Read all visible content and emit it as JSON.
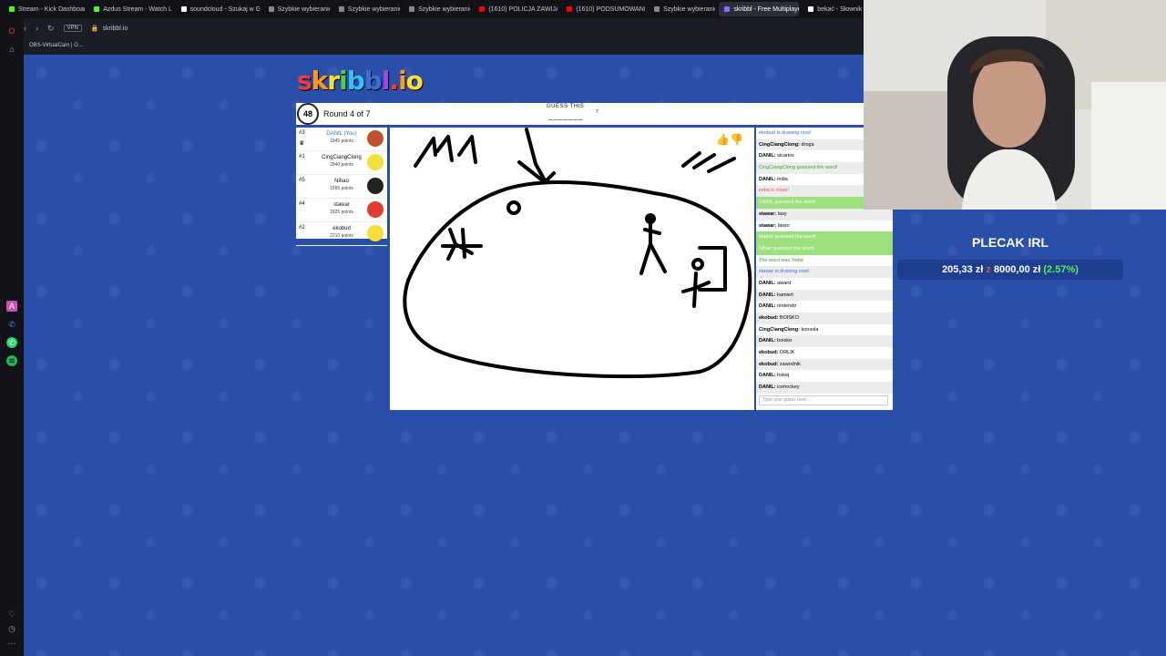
{
  "browser": {
    "tabs": [
      {
        "label": "Stream - Kick Dashboard",
        "color": "#53fc18"
      },
      {
        "label": "Azdus Stream - Watch Liv",
        "color": "#53fc18"
      },
      {
        "label": "soundcloud - Szukaj w Go",
        "color": "#ffffff"
      },
      {
        "label": "Szybkie wybieranie",
        "color": "#888888"
      },
      {
        "label": "Szybkie wybieranie",
        "color": "#888888"
      },
      {
        "label": "Szybkie wybieranie",
        "color": "#888888"
      },
      {
        "label": "(1610) POLICJA ZAWIJA S",
        "color": "#ff0000"
      },
      {
        "label": "(1610) PODSUMOWANIE",
        "color": "#ff0000"
      },
      {
        "label": "Szybkie wybieranie",
        "color": "#888888"
      },
      {
        "label": "skribbl - Free Multiplayer",
        "color": "#8a6cff",
        "active": true
      },
      {
        "label": "bekać - Słownik j",
        "color": "#ffffff"
      }
    ],
    "url": "skribbl.io",
    "vpn": "VPN",
    "bookmark": "OBS-VirtualCam | O..."
  },
  "game": {
    "logo": "skribbl.io",
    "timer": "48",
    "round": "Round 4 of 7",
    "guess_label": "GUESS THIS",
    "word": "_______",
    "word_length": "7",
    "players": [
      {
        "rank": "#3",
        "name": "DANIL (You)",
        "points": "1845 points",
        "you": true,
        "avatar_color": "#c1502e",
        "crown": true
      },
      {
        "rank": "#1",
        "name": "CingCiangClong",
        "points": "2840 points",
        "avatar_color": "#f5e03a"
      },
      {
        "rank": "#5",
        "name": "Nihao",
        "points": "1595 points",
        "avatar_color": "#222222"
      },
      {
        "rank": "#4",
        "name": "stawar",
        "points": "1825 points",
        "avatar_color": "#e53b2d"
      },
      {
        "rank": "#2",
        "name": "ekobud",
        "points": "2210 points",
        "avatar_color": "#f5e03a"
      }
    ],
    "chat": [
      {
        "text": "ekobud is drawing now!",
        "style": "blue"
      },
      {
        "user": "CingCiangClong:",
        "text": " droga",
        "style": "alt"
      },
      {
        "user": "DANIL:",
        "text": " sicarios",
        "style": ""
      },
      {
        "text": "CingCiangClong guessed the word!",
        "style": "green alt"
      },
      {
        "user": "DANIL:",
        "text": " india",
        "style": ""
      },
      {
        "text": "india is close!",
        "style": "red alt"
      },
      {
        "text": "DANIL guessed the word!",
        "style": "greenbg"
      },
      {
        "user": "stawar:",
        "text": " lasy",
        "style": "alt"
      },
      {
        "user": "stawar:",
        "text": " lasso",
        "style": ""
      },
      {
        "text": "stawar guessed the word!",
        "style": "greenbg"
      },
      {
        "text": "Nihao guessed the word!",
        "style": "greenbg"
      },
      {
        "text": "The word was 'India'",
        "style": "green"
      },
      {
        "text": "stawar is drawing now!",
        "style": "blue alt"
      },
      {
        "user": "DANIL:",
        "text": " award",
        "style": ""
      },
      {
        "user": "DANIL:",
        "text": " kamień",
        "style": "alt"
      },
      {
        "user": "DANIL:",
        "text": " nintendo",
        "style": ""
      },
      {
        "user": "ekobud:",
        "text": " BOISKO",
        "style": "alt"
      },
      {
        "user": "CingCiangClong:",
        "text": " konsola",
        "style": ""
      },
      {
        "user": "DANIL:",
        "text": " boisko",
        "style": "alt"
      },
      {
        "user": "ekobud:",
        "text": " ORLIK",
        "style": ""
      },
      {
        "user": "ekobud:",
        "text": " zawodnik",
        "style": "alt"
      },
      {
        "user": "DANIL:",
        "text": " hokej",
        "style": ""
      },
      {
        "user": "DANIL:",
        "text": " icehockey",
        "style": "alt"
      }
    ],
    "chat_placeholder": "Type your guess here..."
  },
  "overlay": {
    "title": "PLECAK IRL",
    "amount": "205,33 zł",
    "of": "z",
    "goal": "8000,00 zł",
    "percent": "(2.57%)"
  }
}
